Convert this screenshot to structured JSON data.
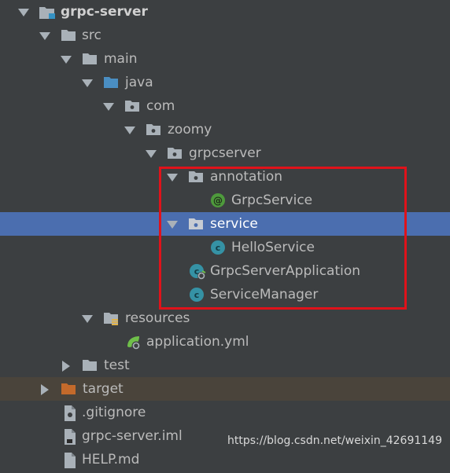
{
  "tree": {
    "items": [
      {
        "label": "grpc-server",
        "icon": "module-folder-icon",
        "expanded": true
      },
      {
        "label": "src",
        "icon": "folder-icon",
        "expanded": true
      },
      {
        "label": "main",
        "icon": "folder-icon",
        "expanded": true
      },
      {
        "label": "java",
        "icon": "source-root-folder-icon",
        "expanded": true
      },
      {
        "label": "com",
        "icon": "package-icon",
        "expanded": true
      },
      {
        "label": "zoomy",
        "icon": "package-icon",
        "expanded": true
      },
      {
        "label": "grpcserver",
        "icon": "package-icon",
        "expanded": true
      },
      {
        "label": "annotation",
        "icon": "package-icon",
        "expanded": true
      },
      {
        "label": "GrpcService",
        "icon": "annotation-icon"
      },
      {
        "label": "service",
        "icon": "package-icon",
        "expanded": true,
        "selected": true
      },
      {
        "label": "HelloService",
        "icon": "class-icon"
      },
      {
        "label": "GrpcServerApplication",
        "icon": "spring-boot-class-icon"
      },
      {
        "label": "ServiceManager",
        "icon": "class-icon"
      },
      {
        "label": "resources",
        "icon": "resources-folder-icon",
        "expanded": true
      },
      {
        "label": "application.yml",
        "icon": "spring-yml-icon"
      },
      {
        "label": "test",
        "icon": "folder-icon",
        "expanded": false
      },
      {
        "label": "target",
        "icon": "excluded-folder-icon",
        "expanded": false
      },
      {
        "label": ".gitignore",
        "icon": "text-file-icon"
      },
      {
        "label": "grpc-server.iml",
        "icon": "iml-file-icon"
      },
      {
        "label": "HELP.md",
        "icon": "markdown-file-icon"
      }
    ]
  },
  "watermark": "https://blog.csdn.net/weixin_42691149",
  "colors": {
    "background": "#3c3f41",
    "selection": "#4b6eaf",
    "excluded_row": "#4a443b",
    "highlight_box": "#e0121a",
    "folder": "#a9b1b8",
    "source_root": "#4a8ec2",
    "excluded_folder": "#c46a2b",
    "class_icon": "#3592a5",
    "annotation_icon": "#4e9a3c"
  }
}
